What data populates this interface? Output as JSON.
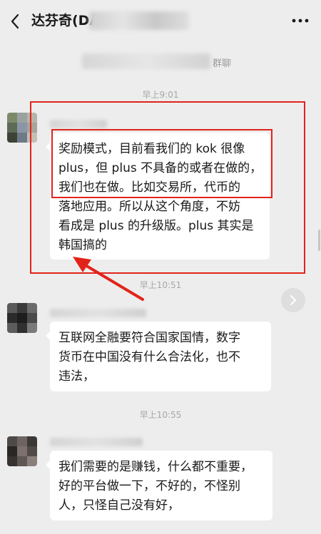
{
  "header": {
    "title": "达芬奇(DA",
    "back_icon": "chevron-left-icon",
    "more_icon": "more-dots-icon"
  },
  "system_notice": {
    "text": "群聊"
  },
  "messages": [
    {
      "timestamp": "早上9:01",
      "lines": [
        "奖励模式，目前看我们的 kok 很像",
        "plus，但 plus 不具备的或者在做的，",
        "我们也在做。比如交易所，代币的",
        "落地应用。所以从这个角度，不妨",
        "看成是 plus 的升级版。plus 其实是",
        "韩国搞的"
      ]
    },
    {
      "timestamp": "早上10:51",
      "lines": [
        "互联网全融要符合国家国情，数字",
        "货币在中国没有什么合法化，也不",
        "违法，"
      ]
    },
    {
      "timestamp": "早上10:55",
      "lines": [
        "我们需要的是赚钱，什么都不重要，",
        "好的平台做一下，不好的，不怪别",
        "人，只怪自己没有好，"
      ]
    }
  ],
  "annotation": {
    "color": "#e2231a"
  },
  "colors": {
    "background": "#ededed",
    "bubble": "#ffffff"
  }
}
